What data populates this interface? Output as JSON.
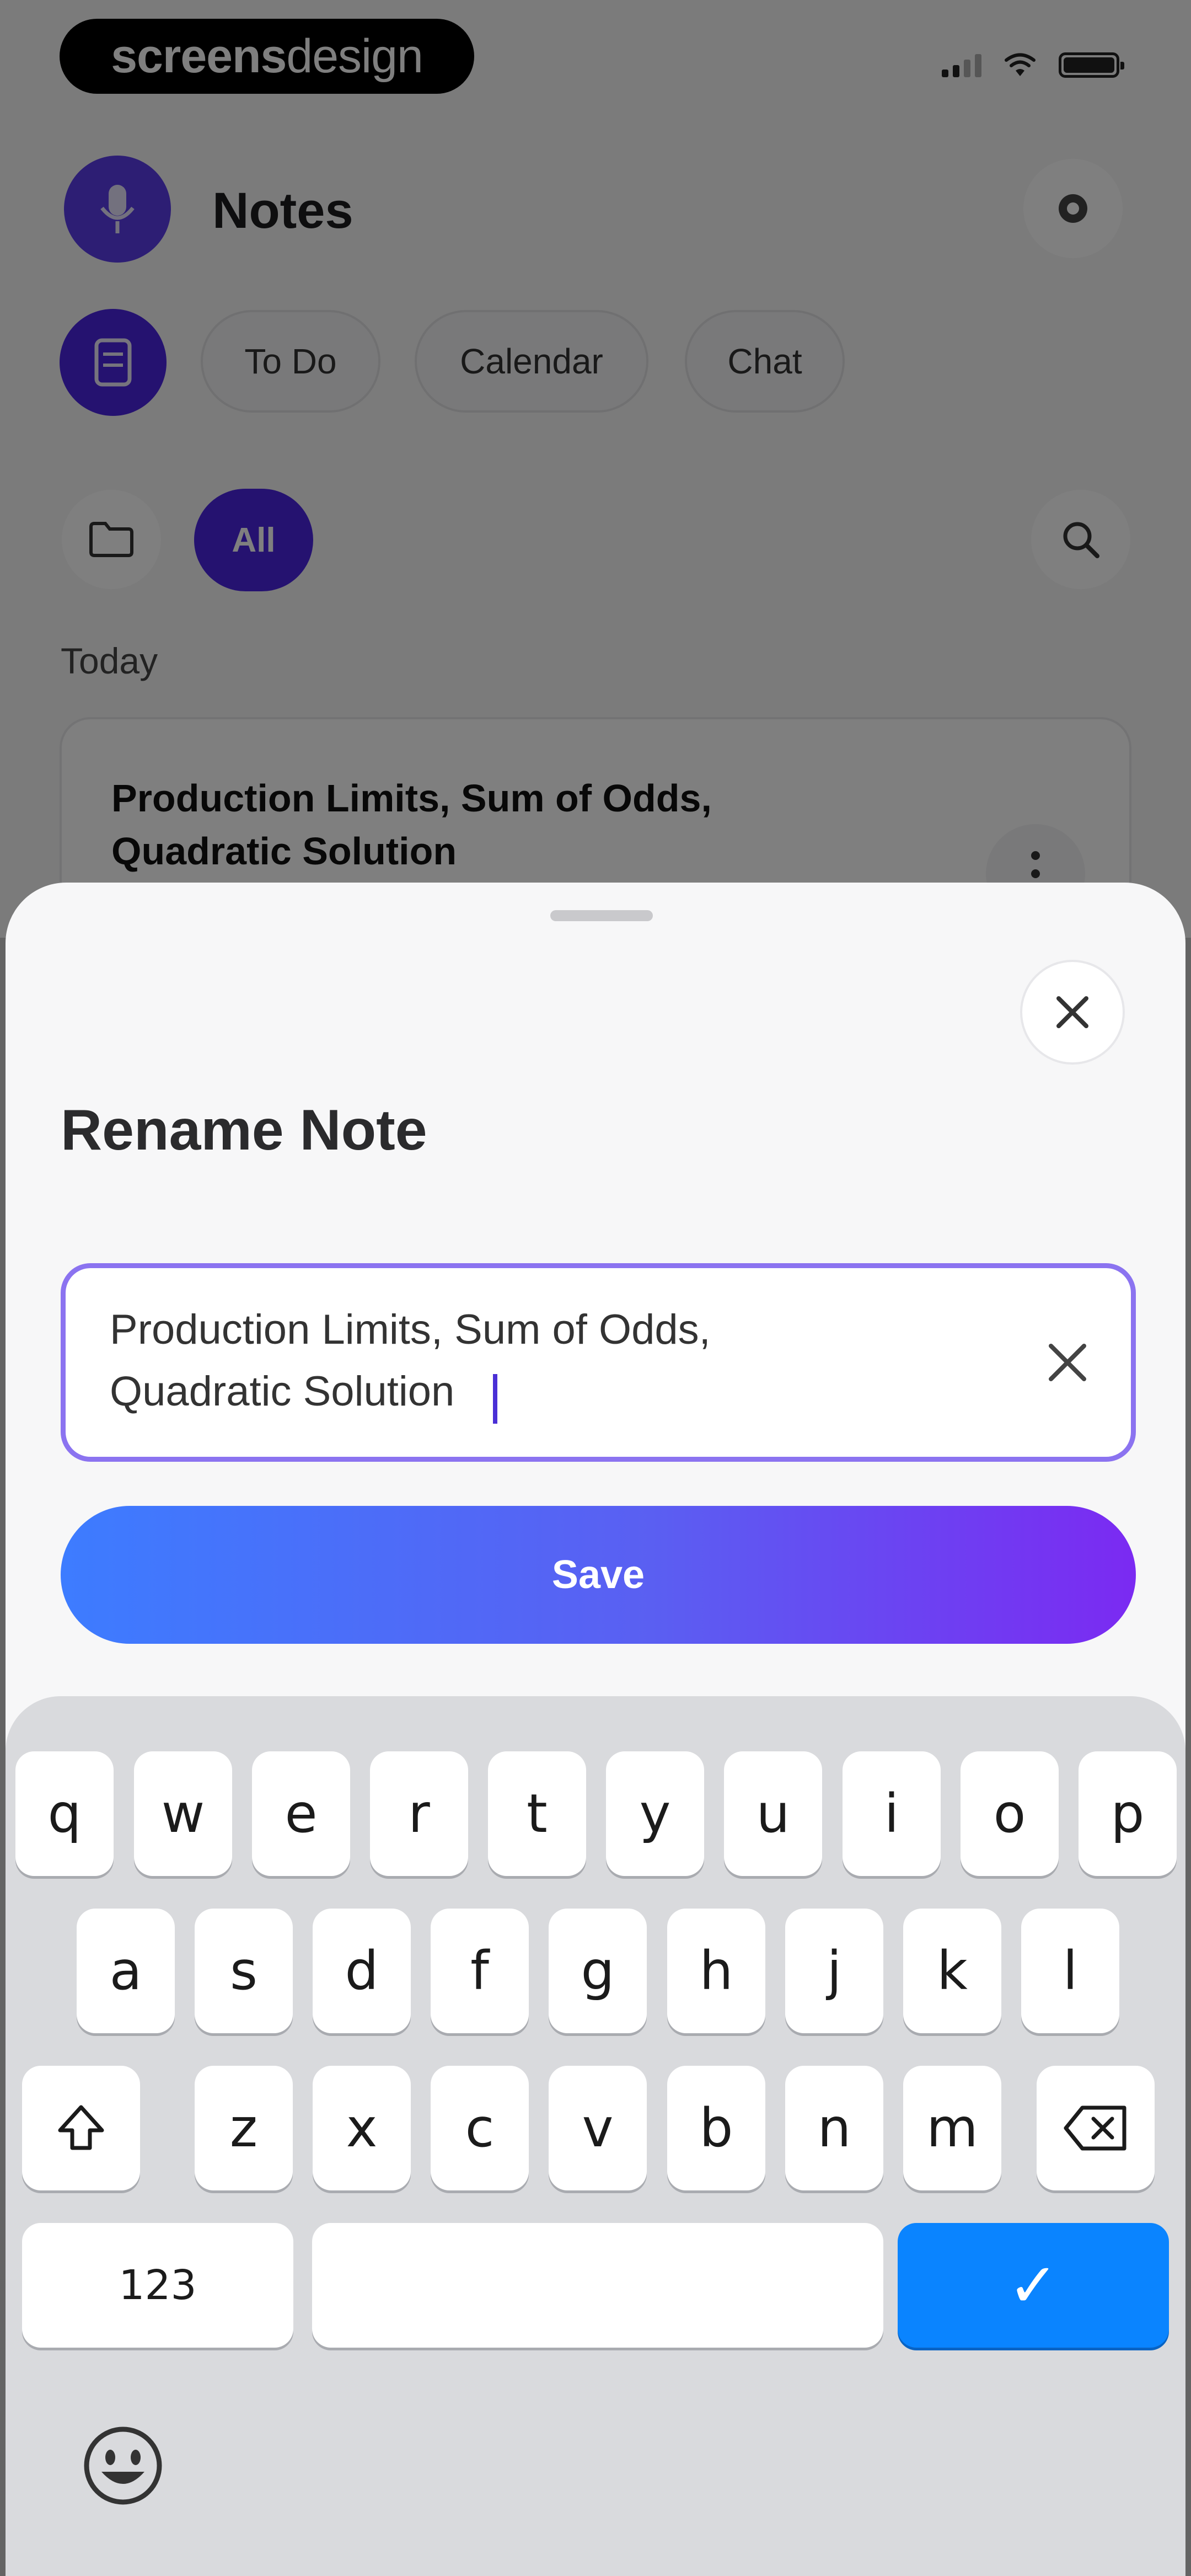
{
  "status_bar": {
    "brand_bold": "screens",
    "brand_light": "design"
  },
  "header": {
    "title": "Notes"
  },
  "tabs": [
    {
      "label": "To Do"
    },
    {
      "label": "Calendar"
    },
    {
      "label": "Chat"
    }
  ],
  "filters": {
    "all_label": "All"
  },
  "list": {
    "section_label": "Today",
    "first_note_title": "Production Limits, Sum of Odds, Quadratic Solution"
  },
  "sheet": {
    "title": "Rename Note",
    "input_value": "Production Limits, Sum of Odds,\nQuadratic Solution",
    "save_label": "Save"
  },
  "keyboard": {
    "row1": [
      "q",
      "w",
      "e",
      "r",
      "t",
      "y",
      "u",
      "i",
      "o",
      "p"
    ],
    "row2": [
      "a",
      "s",
      "d",
      "f",
      "g",
      "h",
      "j",
      "k",
      "l"
    ],
    "row3": [
      "z",
      "x",
      "c",
      "v",
      "b",
      "n",
      "m"
    ],
    "numbers_label": "123",
    "return_symbol": "✓"
  },
  "colors": {
    "accent": "#4a25e0",
    "input_border": "#8b73f0",
    "save_gradient_start": "#3d7cff",
    "save_gradient_end": "#7b2af2",
    "keyboard_go": "#0a84ff"
  },
  "icons": {
    "avatar": "microphone-icon",
    "settings": "gear-icon",
    "note_fab": "notebook-icon",
    "folder": "folder-icon",
    "search": "search-icon",
    "more": "more-vertical-icon",
    "close": "close-icon",
    "clear": "clear-icon",
    "shift": "shift-icon",
    "delete": "backspace-icon",
    "emoji": "emoji-icon"
  }
}
